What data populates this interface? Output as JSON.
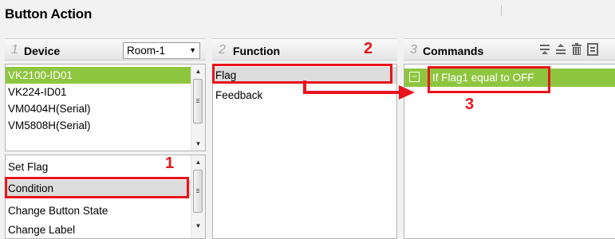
{
  "page": {
    "title": "Button Action"
  },
  "device": {
    "step": "1",
    "header": "Device",
    "room_selected": "Room-1",
    "items": [
      "VK2100-ID01",
      "VK224-ID01",
      "VM0404H(Serial)",
      "VM5808H(Serial)"
    ],
    "selected_index": 0
  },
  "actions": {
    "items": [
      "Set Flag",
      "Condition",
      "Change Button State",
      "Change Label"
    ],
    "highlighted_index": 1
  },
  "function": {
    "step": "2",
    "header": "Function",
    "items": [
      "Flag",
      "Feedback"
    ],
    "highlighted_index": 0
  },
  "commands": {
    "step": "3",
    "header": "Commands",
    "items": [
      {
        "expander": "−",
        "text": "If Flag1 equal to OFF"
      }
    ],
    "toolbar_icons": [
      "move-up-icon",
      "move-down-icon",
      "delete-icon",
      "edit-icon"
    ]
  },
  "annotations": {
    "labels": [
      "1",
      "2",
      "3"
    ],
    "color": "#e8141c"
  },
  "colors": {
    "selection_green": "#8ec63f",
    "highlight_gray": "#dcdcdc",
    "annotation_red": "#e8141c"
  }
}
